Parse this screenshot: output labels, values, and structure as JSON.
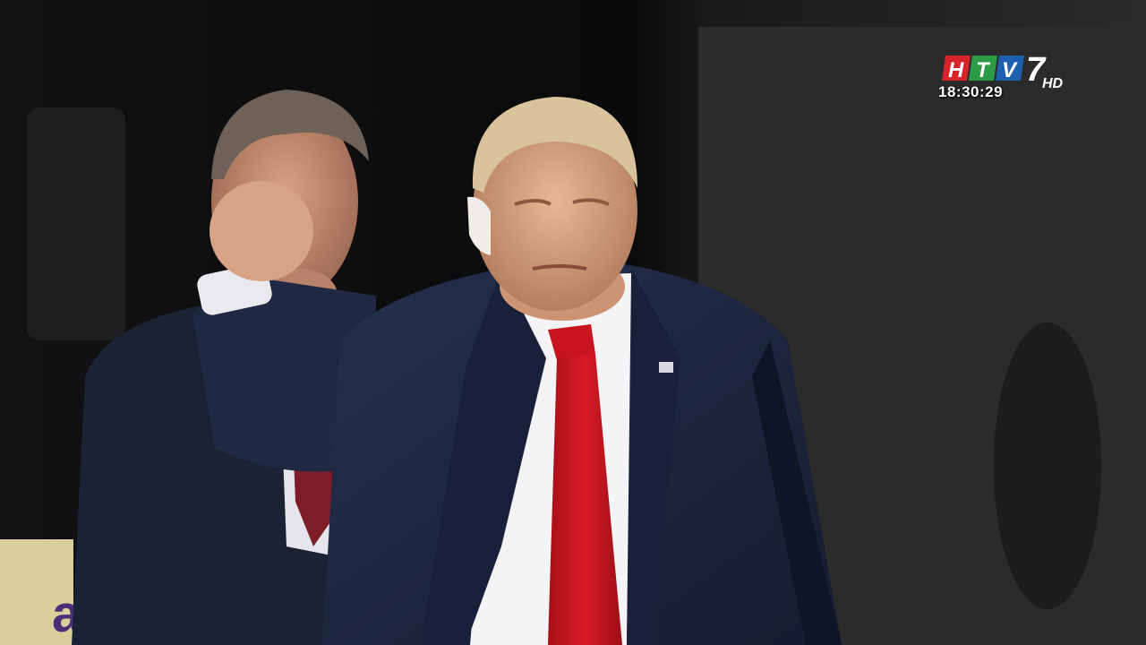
{
  "broadcast": {
    "channel_logo_label": "HTV7 HD",
    "clock": "18:30:29"
  },
  "colors": {
    "background": "#0b0b0c",
    "logo_red": "#d6242b",
    "logo_green": "#2d9a45",
    "logo_blue": "#1f5fb0",
    "tie_red": "#c8141e",
    "suit_navy": "#1d2740"
  }
}
